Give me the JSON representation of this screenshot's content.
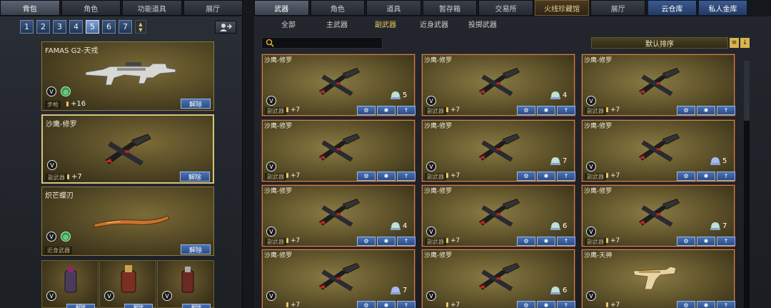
{
  "left_tabs": [
    "背包",
    "角色",
    "功能道具",
    "展厅"
  ],
  "right_tabs": [
    "武器",
    "角色",
    "道具",
    "暂存箱",
    "交易所",
    "火线珍藏馆",
    "展厅"
  ],
  "storage_tabs": [
    "云仓库",
    "私人金库"
  ],
  "pages": [
    "1",
    "2",
    "3",
    "4",
    "5",
    "6",
    "7"
  ],
  "active_page": "5",
  "updown": {
    "up": "▲",
    "down": "▼"
  },
  "inventory": [
    {
      "name": "FAMAS G2-天戎",
      "type": "步枪",
      "plus": "+16",
      "button": "解除"
    },
    {
      "name": "沙鹰-修罗",
      "type": "副武器",
      "plus": "+7",
      "button": "解除"
    },
    {
      "name": "炽芒蝶刃",
      "type": "近身武器",
      "plus": "",
      "button": "解除"
    }
  ],
  "small_button": "解除",
  "subtabs": [
    "全部",
    "主武器",
    "副武器",
    "近身武器",
    "投掷武器"
  ],
  "active_subtab": "副武器",
  "sort_label": "默认排序",
  "badge_v": "V",
  "grid": [
    {
      "name": "沙鹰-修罗",
      "type": "副武器",
      "plus": "+7",
      "count": "5"
    },
    {
      "name": "沙鹰-修罗",
      "type": "副武器",
      "plus": "+7",
      "count": "4"
    },
    {
      "name": "沙鹰-修罗",
      "type": "副武器",
      "plus": "+7",
      "count": ""
    },
    {
      "name": "沙鹰-修罗",
      "type": "副武器",
      "plus": "+7",
      "count": ""
    },
    {
      "name": "沙鹰-修罗",
      "type": "副武器",
      "plus": "+7",
      "count": "7"
    },
    {
      "name": "沙鹰-修罗",
      "type": "副武器",
      "plus": "+7",
      "count": "5"
    },
    {
      "name": "沙鹰-修罗",
      "type": "副武器",
      "plus": "+7",
      "count": "4"
    },
    {
      "name": "沙鹰-修罗",
      "type": "副武器",
      "plus": "+7",
      "count": "6"
    },
    {
      "name": "沙鹰-修罗",
      "type": "副武器",
      "plus": "+7",
      "count": "7"
    },
    {
      "name": "沙鹰-修罗",
      "type": "",
      "plus": "+7",
      "count": "7"
    },
    {
      "name": "沙鹰-修罗",
      "type": "",
      "plus": "+7",
      "count": "6"
    },
    {
      "name": "沙鹰-天神",
      "type": "",
      "plus": "+7",
      "count": ""
    }
  ],
  "colors": {
    "accent_gold": "#f0c75e",
    "button_blue": "#2b4c86",
    "card_border_red": "#7d2f2a"
  }
}
